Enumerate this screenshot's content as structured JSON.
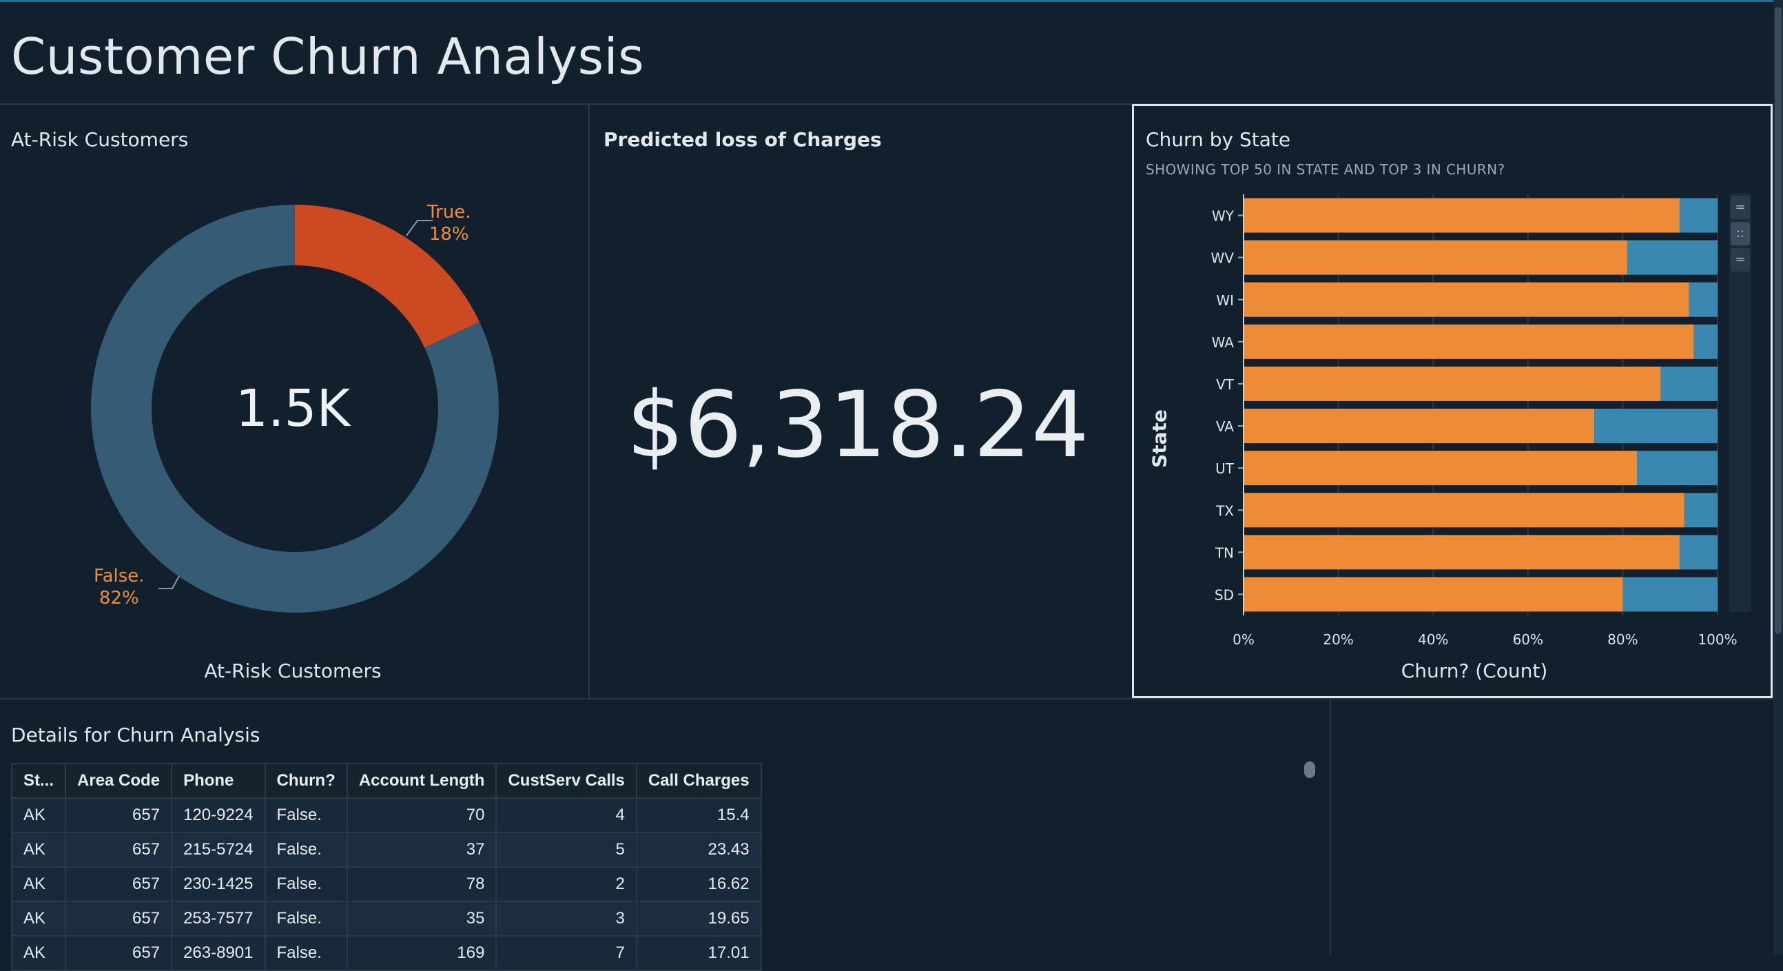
{
  "page": {
    "title": "Customer Churn Analysis"
  },
  "at_risk": {
    "title": "At-Risk Customers",
    "center_value": "1.5K",
    "axis_label": "At-Risk Customers",
    "slices": [
      {
        "label": "True.",
        "pct_text": "18%",
        "value": 18,
        "color": "#cc4a21"
      },
      {
        "label": "False.",
        "pct_text": "82%",
        "value": 82,
        "color": "#365b75"
      }
    ]
  },
  "kpi": {
    "title": "Predicted loss of Charges",
    "value": "$6,318.24"
  },
  "churn_by_state": {
    "title": "Churn by State",
    "subtitle": "SHOWING TOP 50 IN STATE AND TOP 3 IN CHURN?",
    "y_axis_title": "State",
    "x_axis_title": "Churn? (Count)",
    "x_ticks": [
      "0%",
      "20%",
      "40%",
      "60%",
      "80%",
      "100%"
    ]
  },
  "chart_data": {
    "type": "bar",
    "orientation": "horizontal-stacked-100",
    "title": "Churn by State",
    "xlabel": "Churn? (Count)",
    "ylabel": "State",
    "xlim": [
      0,
      100
    ],
    "categories": [
      "WY",
      "WV",
      "WI",
      "WA",
      "VT",
      "VA",
      "UT",
      "TX",
      "TN",
      "SD"
    ],
    "series": [
      {
        "color": "#ed8b36",
        "values": [
          92,
          81,
          94,
          95,
          88,
          74,
          83,
          93,
          92,
          80
        ]
      },
      {
        "color": "#3a87b0",
        "values": [
          8,
          19,
          6,
          5,
          12,
          26,
          17,
          7,
          8,
          20
        ]
      }
    ],
    "grid": true
  },
  "details": {
    "title": "Details for Churn Analysis",
    "columns": [
      "St...",
      "Area Code",
      "Phone",
      "Churn?",
      "Account Length",
      "CustServ Calls",
      "Call Charges"
    ],
    "rows": [
      [
        "AK",
        "657",
        "120-9224",
        "False.",
        "70",
        "4",
        "15.4"
      ],
      [
        "AK",
        "657",
        "215-5724",
        "False.",
        "37",
        "5",
        "23.43"
      ],
      [
        "AK",
        "657",
        "230-1425",
        "False.",
        "78",
        "2",
        "16.62"
      ],
      [
        "AK",
        "657",
        "253-7577",
        "False.",
        "35",
        "3",
        "19.65"
      ],
      [
        "AK",
        "657",
        "263-8901",
        "False.",
        "169",
        "7",
        "17.01"
      ]
    ]
  }
}
